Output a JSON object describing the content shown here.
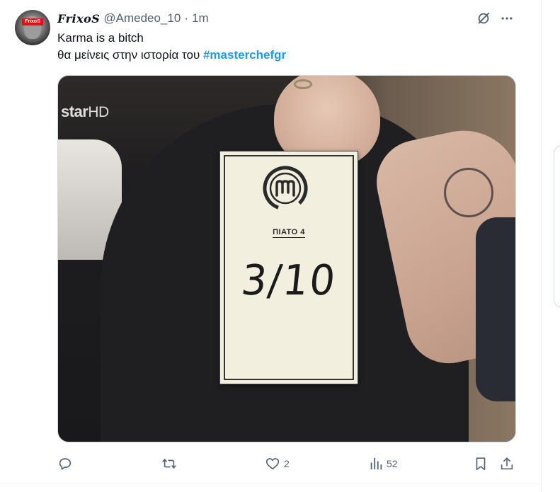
{
  "tweet": {
    "display_name": "FrixoS",
    "handle": "@Amedeo_10",
    "separator": "·",
    "time": "1m",
    "avatar_tag": "FrixoS",
    "line1": "Karma is a bitch",
    "line2_prefix": "θα μείνεις στην ιστορία του ",
    "hashtag": "#masterchefgr"
  },
  "media": {
    "watermark_brand": "star",
    "watermark_suffix": "HD",
    "card_dish": "ΠΙΑΤΟ 4",
    "card_score": "3/10"
  },
  "actions": {
    "reply_count": "",
    "retweet_count": "",
    "like_count": "2",
    "views_count": "52"
  },
  "icons": {
    "grok": "grok-icon",
    "more": "more-icon",
    "reply": "reply-icon",
    "retweet": "retweet-icon",
    "like": "heart-icon",
    "views": "views-icon",
    "bookmark": "bookmark-icon",
    "share": "share-icon"
  },
  "colors": {
    "text": "#0f1419",
    "secondary": "#536471",
    "link": "#1d9bf0",
    "border": "#eff3f4"
  }
}
